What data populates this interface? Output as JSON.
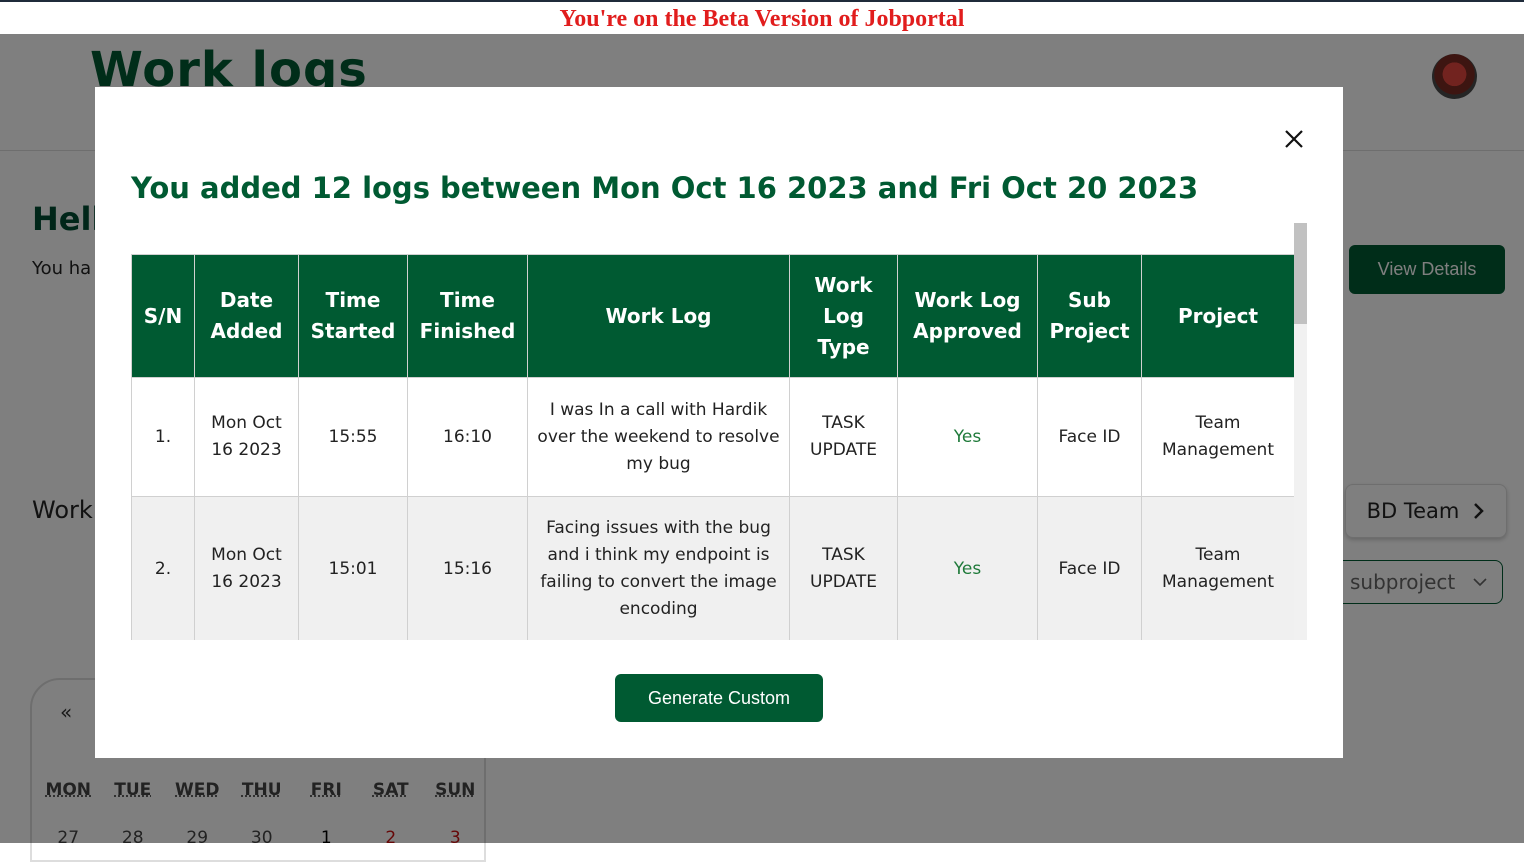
{
  "beta_banner": "You're on the Beta Version of Jobportal",
  "page": {
    "title": "Work logs",
    "hello": "Hell",
    "you_have": "You ha",
    "view_details": "View Details",
    "work_label": "Work",
    "team_button": "BD Team",
    "subproject_placeholder": "subproject"
  },
  "calendar": {
    "prev": "«",
    "weekdays": [
      "MON",
      "TUE",
      "WED",
      "THU",
      "FRI",
      "SAT",
      "SUN"
    ],
    "dates": [
      "27",
      "28",
      "29",
      "30",
      "1",
      "2",
      "3"
    ]
  },
  "modal": {
    "title": "You added 12 logs between Mon Oct 16 2023 and Fri Oct 20 2023",
    "columns": [
      "S/N",
      "Date Added",
      "Time Started",
      "Time Finished",
      "Work Log",
      "Work Log Type",
      "Work Log Approved",
      "Sub Project",
      "Project"
    ],
    "rows": [
      {
        "sn": "1.",
        "date": "Mon Oct 16 2023",
        "started": "15:55",
        "finished": "16:10",
        "log": "I was In a call with Hardik over the weekend to resolve my bug",
        "type": "TASK UPDATE",
        "approved": "Yes",
        "sub_project": "Face ID",
        "project": "Team Management"
      },
      {
        "sn": "2.",
        "date": "Mon Oct 16 2023",
        "started": "15:01",
        "finished": "15:16",
        "log": "Facing issues with the bug and i think my endpoint is failing to convert the image encoding",
        "type": "TASK UPDATE",
        "approved": "Yes",
        "sub_project": "Face ID",
        "project": "Team Management"
      }
    ],
    "generate_button": "Generate Custom"
  },
  "colors": {
    "brand_green": "#005a32",
    "beta_red": "#e11d1d",
    "approved_green": "#1f7a3a"
  }
}
